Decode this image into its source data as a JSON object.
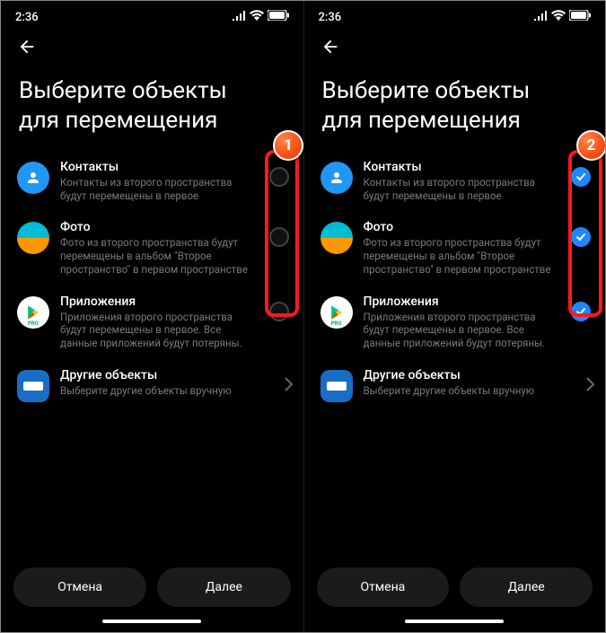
{
  "statusbar": {
    "time": "2:36"
  },
  "heading": {
    "line1": "Выберите объекты",
    "line2": "для перемещения"
  },
  "items": {
    "contacts": {
      "title": "Контакты",
      "sub": "Контакты из второго пространства будут перемещены в первое"
    },
    "photos": {
      "title": "Фото",
      "sub": "Фото из второго пространства будут перемещены в альбом \"Второе пространство\" в первом пространстве"
    },
    "apps": {
      "title": "Приложения",
      "sub": "Приложения второго пространства будут перемещены в первое. Все данные приложений будут потеряны."
    },
    "other": {
      "title": "Другие объекты",
      "sub": "Выберите другие объекты вручную"
    }
  },
  "buttons": {
    "cancel": "Отмена",
    "next": "Далее"
  },
  "annotations": {
    "left": "1",
    "right": "2"
  },
  "iconLabels": {
    "play_pro": "PRO"
  }
}
